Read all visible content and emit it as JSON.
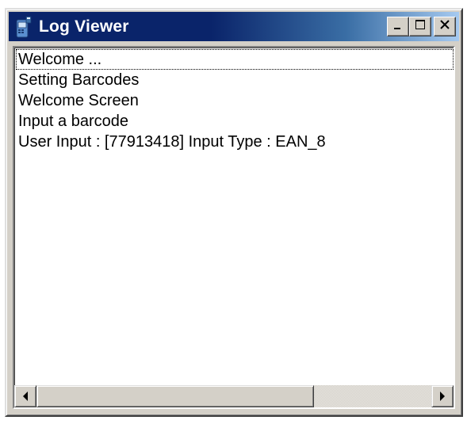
{
  "window": {
    "title": "Log Viewer",
    "icon": "barcode-scanner-icon"
  },
  "title_buttons": {
    "minimize_icon": "minimize-icon",
    "maximize_icon": "maximize-icon",
    "close_icon": "close-icon"
  },
  "log": {
    "lines": [
      "Welcome ...",
      "Setting Barcodes",
      "Welcome Screen",
      "Input a barcode",
      "User Input : [77913418] Input Type : EAN_8"
    ],
    "focused_index": 0
  },
  "scrollbar": {
    "left_icon": "arrow-left-icon",
    "right_icon": "arrow-right-icon",
    "position_fraction": 0.0
  },
  "colors": {
    "titlebar_active": "#0a246a",
    "titlebar_gradient_end": "#a6caf0",
    "face": "#d4d0c8"
  }
}
